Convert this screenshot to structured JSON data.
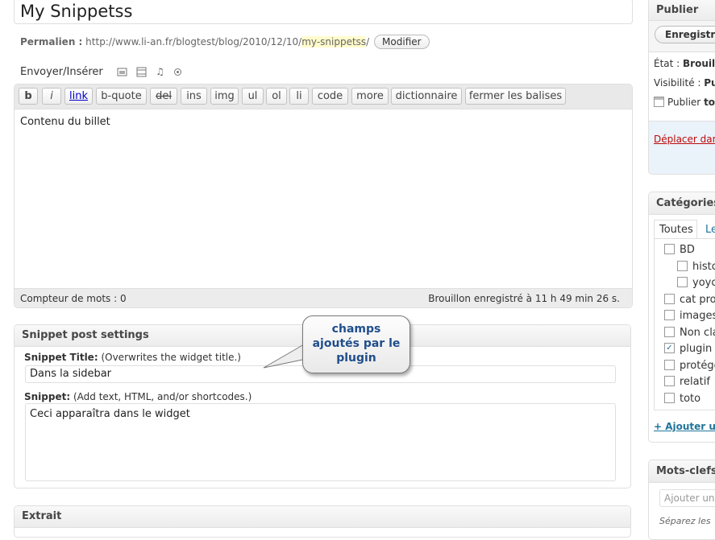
{
  "post": {
    "title": "My Snippetss",
    "permalink_label": "Permalien :",
    "permalink_base": "http://www.li-an.fr/blogtest/blog/2010/12/10/",
    "permalink_slug": "my-snippetss",
    "permalink_end": "/",
    "edit_permalink_button": "Modifier"
  },
  "media": {
    "label": "Envoyer/Insérer",
    "icons": [
      "image-icon",
      "video-icon",
      "audio-icon",
      "media-icon"
    ]
  },
  "editor": {
    "quicktags": [
      "b",
      "i",
      "link",
      "b-quote",
      "del",
      "ins",
      "img",
      "ul",
      "ol",
      "li",
      "code",
      "more",
      "dictionnaire",
      "fermer les balises"
    ],
    "content": "Contenu du billet",
    "word_count": "Compteur de mots : 0",
    "autosave": "Brouillon enregistré à 11 h 49 min 26 s."
  },
  "snippet_box": {
    "heading": "Snippet post settings",
    "title_label": "Snippet Title:",
    "title_hint": "(Overwrites the widget title.)",
    "title_value": "Dans la sidebar",
    "snippet_label": "Snippet:",
    "snippet_hint": "(Add text, HTML, and/or shortcodes.)",
    "snippet_value": "Ceci apparaîtra dans le widget"
  },
  "callout": {
    "line1": "champs",
    "line2": "ajoutés par le",
    "line3": "plugin"
  },
  "excerpt_box": {
    "heading": "Extrait"
  },
  "publish_box": {
    "heading": "Publier",
    "save_button": "Enregistre",
    "status_label": "État :",
    "status_value": "Brouill",
    "visibility_label": "Visibilité :",
    "visibility_value": "Pu",
    "publish_label": "Publier",
    "publish_value": "tou",
    "trash_link": "Déplacer dan"
  },
  "categories_box": {
    "heading": "Catégories",
    "tab_all": "Toutes",
    "tab_popular": "Le",
    "items": [
      {
        "label": "BD",
        "checked": false,
        "indent": 0
      },
      {
        "label": "histo",
        "checked": false,
        "indent": 1
      },
      {
        "label": "yoyo",
        "checked": false,
        "indent": 1
      },
      {
        "label": "cat prot",
        "checked": false,
        "indent": 0
      },
      {
        "label": "images",
        "checked": false,
        "indent": 0
      },
      {
        "label": "Non cla",
        "checked": false,
        "indent": 0
      },
      {
        "label": "plugin",
        "checked": true,
        "indent": 0
      },
      {
        "label": "protége",
        "checked": false,
        "indent": 0
      },
      {
        "label": "relatif",
        "checked": false,
        "indent": 0
      },
      {
        "label": "toto",
        "checked": false,
        "indent": 0
      }
    ],
    "add_link": "+ Ajouter u"
  },
  "tags_box": {
    "heading": "Mots-clefs",
    "input_placeholder": "Ajouter un",
    "hint": "Séparez les"
  },
  "colors": {
    "link": "#21759b",
    "trash": "#bc0b0b",
    "callout_text": "#1f4e8c",
    "slug_highlight": "#fffbcc"
  }
}
